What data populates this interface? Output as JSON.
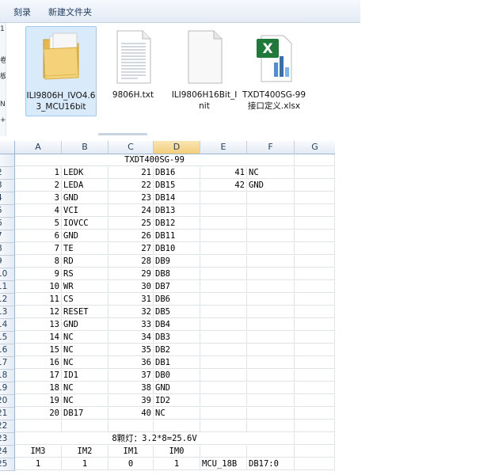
{
  "toolbar": {
    "burn_label": "刻录",
    "new_folder_label": "新建文件夹"
  },
  "nav_glyphs": [
    "1",
    "卷",
    "板",
    "N",
    "+"
  ],
  "files": [
    {
      "name": "ILI9806H_IVO4.63_MCU16bit",
      "icon": "folder-icon",
      "selected": true
    },
    {
      "name": "9806H.txt",
      "icon": "text-file-icon",
      "selected": false
    },
    {
      "name": "ILI9806H16Bit_Init",
      "icon": "blank-file-icon",
      "selected": false
    },
    {
      "name": "TXDT400SG-99接口定义.xlsx",
      "icon": "excel-file-icon",
      "selected": false
    }
  ],
  "sheet": {
    "columns": [
      "A",
      "B",
      "C",
      "D",
      "E",
      "F",
      "G"
    ],
    "active_column": "D",
    "title": "TXDT400SG-99",
    "pins": [
      {
        "row": "2",
        "a": "1",
        "b": "LEDK",
        "c": "21",
        "d": "DB16",
        "e": "41",
        "f": "NC"
      },
      {
        "row": "3",
        "a": "2",
        "b": "LEDA",
        "c": "22",
        "d": "DB15",
        "e": "42",
        "f": "GND"
      },
      {
        "row": "4",
        "a": "3",
        "b": "GND",
        "c": "23",
        "d": "DB14",
        "e": "",
        "f": ""
      },
      {
        "row": "5",
        "a": "4",
        "b": "VCI",
        "c": "24",
        "d": "DB13",
        "e": "",
        "f": ""
      },
      {
        "row": "6",
        "a": "5",
        "b": "IOVCC",
        "c": "25",
        "d": "DB12",
        "e": "",
        "f": ""
      },
      {
        "row": "7",
        "a": "6",
        "b": "GND",
        "c": "26",
        "d": "DB11",
        "e": "",
        "f": ""
      },
      {
        "row": "8",
        "a": "7",
        "b": "TE",
        "c": "27",
        "d": "DB10",
        "e": "",
        "f": ""
      },
      {
        "row": "9",
        "a": "8",
        "b": "RD",
        "c": "28",
        "d": "DB9",
        "e": "",
        "f": ""
      },
      {
        "row": "10",
        "a": "9",
        "b": "RS",
        "c": "29",
        "d": "DB8",
        "e": "",
        "f": ""
      },
      {
        "row": "11",
        "a": "10",
        "b": "WR",
        "c": "30",
        "d": "DB7",
        "e": "",
        "f": ""
      },
      {
        "row": "12",
        "a": "11",
        "b": "CS",
        "c": "31",
        "d": "DB6",
        "e": "",
        "f": ""
      },
      {
        "row": "13",
        "a": "12",
        "b": "RESET",
        "c": "32",
        "d": "DB5",
        "e": "",
        "f": ""
      },
      {
        "row": "14",
        "a": "13",
        "b": "GND",
        "c": "33",
        "d": "DB4",
        "e": "",
        "f": ""
      },
      {
        "row": "15",
        "a": "14",
        "b": "NC",
        "c": "34",
        "d": "DB3",
        "e": "",
        "f": ""
      },
      {
        "row": "16",
        "a": "15",
        "b": "NC",
        "c": "35",
        "d": "DB2",
        "e": "",
        "f": ""
      },
      {
        "row": "17",
        "a": "16",
        "b": "NC",
        "c": "36",
        "d": "DB1",
        "e": "",
        "f": ""
      },
      {
        "row": "18",
        "a": "17",
        "b": "ID1",
        "c": "37",
        "d": "DB0",
        "e": "",
        "f": ""
      },
      {
        "row": "19",
        "a": "18",
        "b": "NC",
        "c": "38",
        "d": "GND",
        "e": "",
        "f": ""
      },
      {
        "row": "20",
        "a": "19",
        "b": "NC",
        "c": "39",
        "d": "ID2",
        "e": "",
        "f": ""
      },
      {
        "row": "21",
        "a": "20",
        "b": "DB17",
        "c": "40",
        "d": "NC",
        "e": "",
        "f": ""
      }
    ],
    "led_note": "8颗灯：3.2*8=25.6V",
    "im_headers": [
      "IM3",
      "IM2",
      "IM1",
      "IM0"
    ],
    "im_values": [
      "1",
      "1",
      "0",
      "1"
    ],
    "mode": "MCU_18B",
    "bus": "DB17:0"
  },
  "colors": {
    "toolbar_text": "#1e395b",
    "selection_bg": "#d9ebfb",
    "active_header": "#f3ce7a",
    "excel_green": "#1f7a3a"
  }
}
